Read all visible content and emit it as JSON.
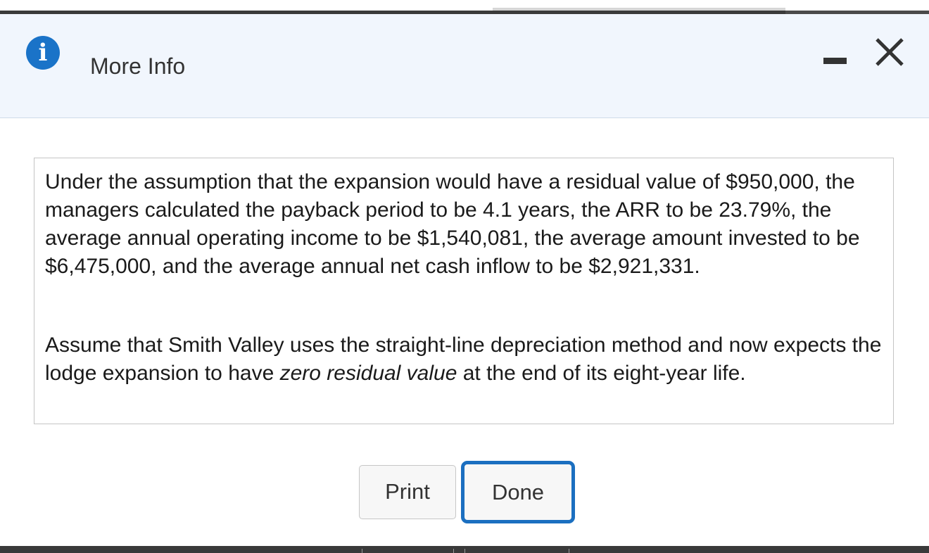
{
  "dialog": {
    "title": "More Info",
    "icons": {
      "info": "info-icon",
      "minimize": "minimize-icon",
      "close": "close-icon"
    },
    "info_glyph": "i",
    "accent_color": "#1a73c8",
    "header_background": "#f1f6fd"
  },
  "content": {
    "paragraph1": "Under the assumption that the expansion would have a residual value of $950,000, the managers calculated the payback period to be 4.1 years, the ARR to be 23.79%, the average annual operating income to be $1,540,081, the average amount invested to be $6,475,000, and the average annual net cash inflow to be $2,921,331.",
    "paragraph2": {
      "before": "Assume that Smith Valley uses the straight-line depreciation method and now expects the lodge expansion to have ",
      "emphasis": "zero residual value",
      "after": " at the end of its eight-year life."
    }
  },
  "buttons": {
    "print": "Print",
    "done": "Done"
  }
}
